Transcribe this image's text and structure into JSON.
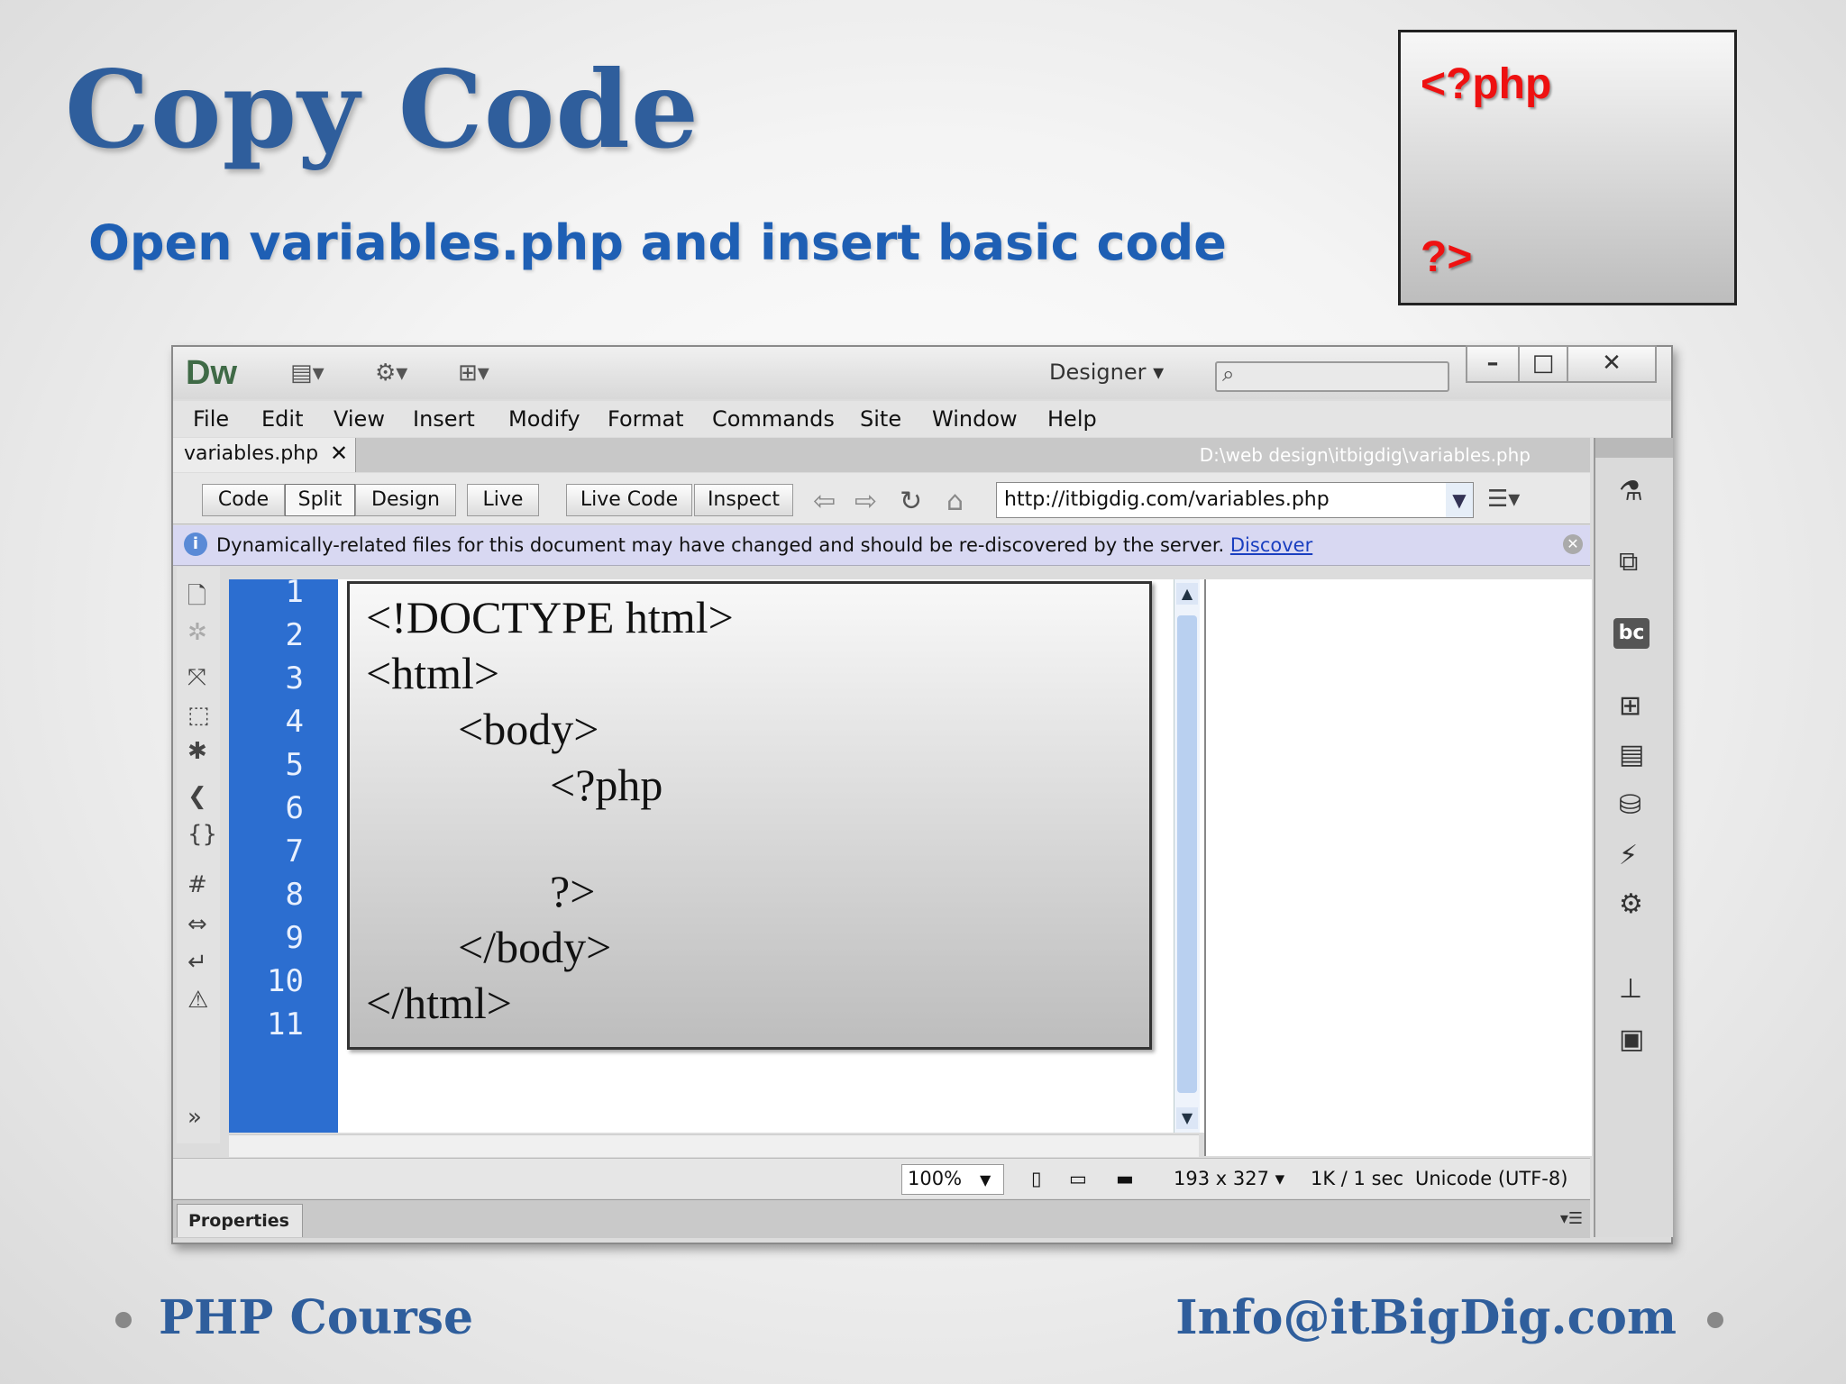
{
  "slide": {
    "title": "Copy Code",
    "subtitle": "Open variables.php and insert basic code",
    "php_box": {
      "line1": "<?php",
      "line2": "?>"
    },
    "footer_left": "PHP Course",
    "footer_right": "Info@itBigDig.com"
  },
  "dw": {
    "logo": "Dw",
    "workspace": "Designer",
    "window_buttons": {
      "minimize": "–",
      "maximize": "□",
      "close": "✕"
    },
    "menu": [
      "File",
      "Edit",
      "View",
      "Insert",
      "Modify",
      "Format",
      "Commands",
      "Site",
      "Window",
      "Help"
    ],
    "doc_tab": {
      "name": "variables.php",
      "close": "✕"
    },
    "doc_path": "D:\\web design\\itbigdig\\variables.php",
    "view_buttons": [
      "Code",
      "Split",
      "Design",
      "Live"
    ],
    "live_buttons": [
      "Live Code",
      "Inspect"
    ],
    "url": "http://itbigdig.com/variables.php",
    "info": {
      "message": "Dynamically-related files for this document may have changed and should be re-discovered by the server.",
      "link": "Discover"
    },
    "line_numbers": [
      "1",
      "2",
      "3",
      "4",
      "5",
      "6",
      "7",
      "8",
      "9",
      "10",
      "11"
    ],
    "code_lines": [
      "<!DOCTYPE html>",
      "<html>",
      "<body>",
      "<?php",
      "",
      "?>",
      "</body>",
      "</html>"
    ],
    "status": {
      "zoom": "100%",
      "dimensions": "193 x 327",
      "size": "1K / 1 sec",
      "encoding": "Unicode (UTF-8)"
    },
    "properties_tab": "Properties"
  },
  "icons": {
    "layout": "layout-icon",
    "gear": "gear-icon",
    "sitemap": "sitemap-icon",
    "search": "search-icon",
    "back": "back-arrow-icon",
    "forward": "forward-arrow-icon",
    "refresh": "refresh-icon",
    "home": "home-icon"
  },
  "colors": {
    "title": "#2f5e9c",
    "subtitle": "#1e5fb4",
    "php_tag": "#ee1111",
    "gutter": "#2c6ed0"
  }
}
